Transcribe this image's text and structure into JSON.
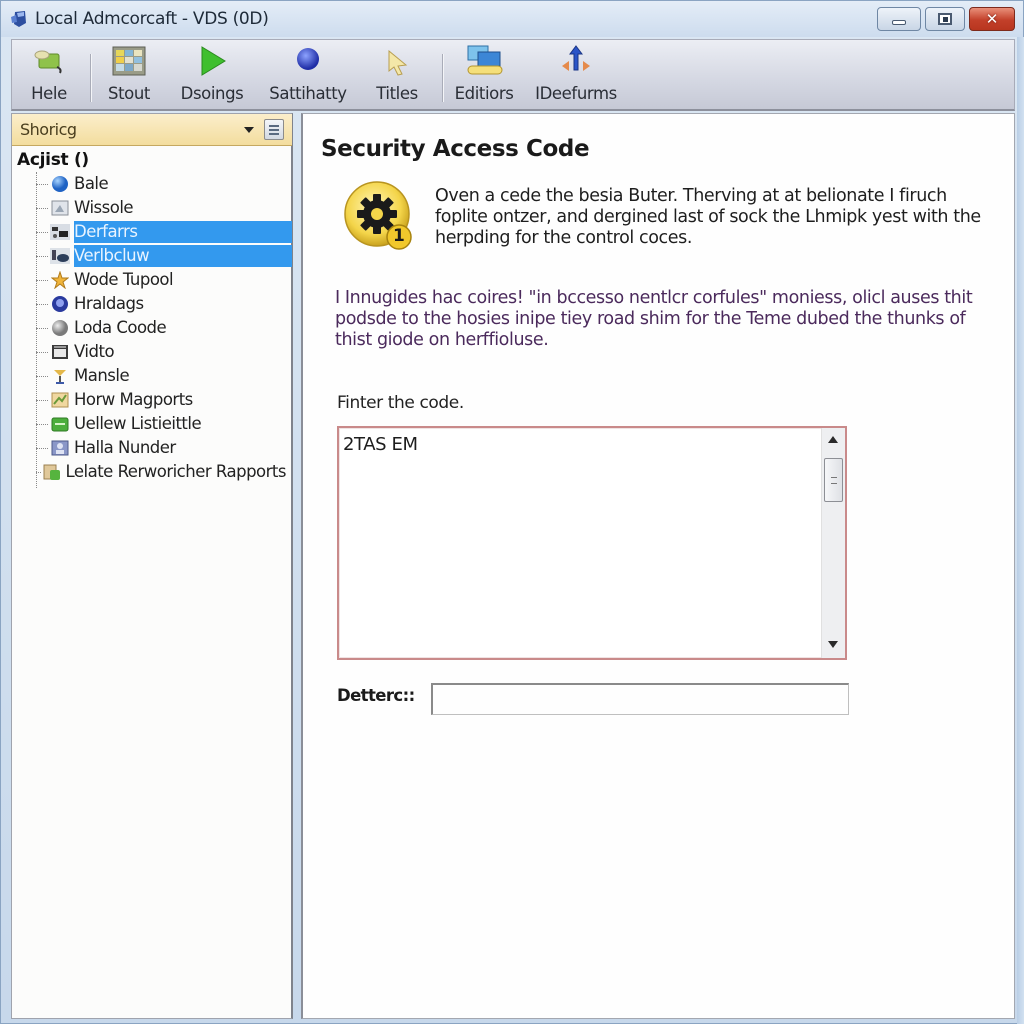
{
  "window": {
    "title": "Local Admcorcaft - VDS (0D)",
    "app_icon": "app-icon",
    "controls": {
      "minimize": "minimize-icon",
      "maximize": "maximize-icon",
      "close": "close-icon",
      "close_glyph": "✕"
    }
  },
  "toolbar": {
    "buttons": [
      {
        "label": "Hele",
        "icon": "help-icon"
      },
      {
        "label": "Stout",
        "icon": "grid-icon"
      },
      {
        "label": "Dsoings",
        "icon": "play-icon"
      },
      {
        "label": "Sattihatty",
        "icon": "globe-icon"
      },
      {
        "label": "Titles",
        "icon": "cursor-icon"
      },
      {
        "label": "Editiors",
        "icon": "monitor-icon"
      },
      {
        "label": "IDeefurms",
        "icon": "arrows-icon"
      }
    ]
  },
  "sidebar": {
    "dropdown": {
      "selected": "Shoricg"
    },
    "root_label": "Acjist ()",
    "items": [
      {
        "label": "Bale",
        "icon": "sphere-icon",
        "selected": false
      },
      {
        "label": "Wissole",
        "icon": "window-icon",
        "selected": false
      },
      {
        "label": "Derfarrs",
        "icon": "tools-icon",
        "selected": true
      },
      {
        "label": "Verlbcluw",
        "icon": "camera-icon",
        "selected": true
      },
      {
        "label": "Wode Tupool",
        "icon": "star-icon",
        "selected": false
      },
      {
        "label": "Hraldags",
        "icon": "shield-icon",
        "selected": false
      },
      {
        "label": "Loda Coode",
        "icon": "disc-icon",
        "selected": false
      },
      {
        "label": "Vidto",
        "icon": "video-icon",
        "selected": false
      },
      {
        "label": "Mansle",
        "icon": "wand-icon",
        "selected": false
      },
      {
        "label": "Horw Magports",
        "icon": "chart-icon",
        "selected": false
      },
      {
        "label": "Uellew Listieittle",
        "icon": "list-icon",
        "selected": false
      },
      {
        "label": "Halla Nunder",
        "icon": "user-icon",
        "selected": false
      },
      {
        "label": "Lelate Rerworicher Rapports",
        "icon": "report-icon",
        "selected": false
      }
    ]
  },
  "main": {
    "title": "Security Access Code",
    "badge_icon": "gear-badge-icon",
    "badge_number": "1",
    "intro": "Oven a cede the besia Buter. Therving at at belionate I firuch foplite ontzer, and dergined last of sock the Lhmipk yest with the herpding for the control coces.",
    "notice": "I Innugides hac coires! \"in bccesso nentlcr corfules\" moniess, olicl auses thit podsde to the hosies inipe tiey road shim for the Teme dubed the thunks of thist giode on herffioluse.",
    "code_label": "Finter the code.",
    "code_value": "2TAS EM",
    "detect_label": "Detterc::",
    "detect_value": ""
  },
  "colors": {
    "selection": "#3399ee",
    "dropdown_bg": "#f3dd9e",
    "code_border": "#c98a8a",
    "notice_text": "#4b2a5c",
    "close_button": "#c3402a"
  }
}
